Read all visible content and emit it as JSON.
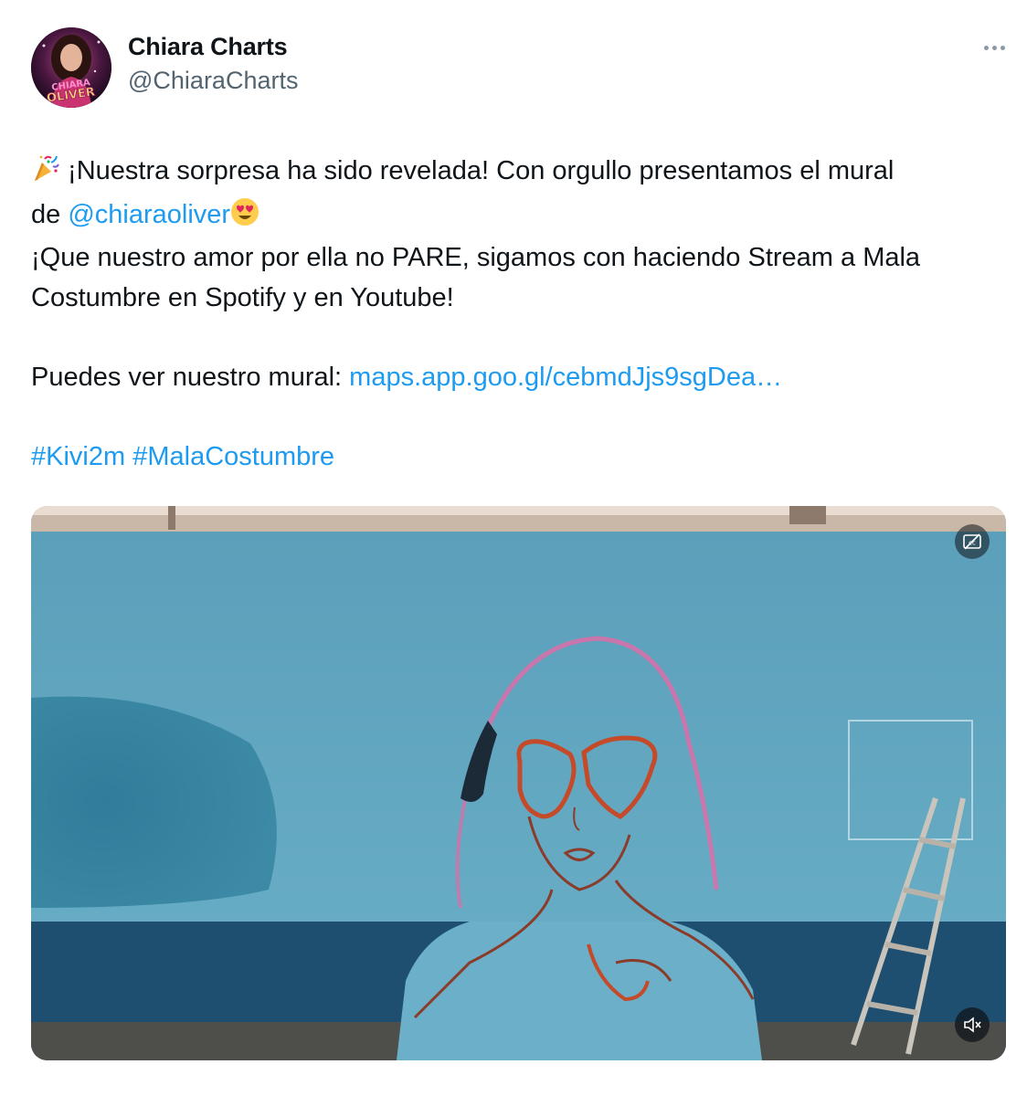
{
  "author": {
    "name": "Chiara Charts",
    "handle": "@ChiaraCharts",
    "avatar_text_top": "CHIARA",
    "avatar_text_bottom": "OLIVER"
  },
  "tweet": {
    "line1_text": " ¡Nuestra sorpresa ha sido revelada! Con orgullo presentamos el mural",
    "line2_prefix": "de ",
    "mention": "@chiaraoliver",
    "line3_text": "¡Que nuestro amor por ella no PARE, sigamos con haciendo Stream a Mala",
    "line4_text": "Costumbre en Spotify y en Youtube!",
    "link_prefix": "Puedes ver nuestro mural: ",
    "link_text": "maps.app.goo.gl/cebmdJjs9sgDea…",
    "hashtags": [
      "#Kivi2m",
      "#MalaCostumbre"
    ],
    "emoji_party": "party-popper",
    "emoji_heart_eyes": "heart-eyes"
  },
  "media": {
    "type": "video",
    "description_icons": [
      "captions-icon",
      "mute-icon"
    ]
  },
  "colors": {
    "link": "#1d9bf0",
    "text": "#0f1419",
    "secondary": "#536471"
  }
}
